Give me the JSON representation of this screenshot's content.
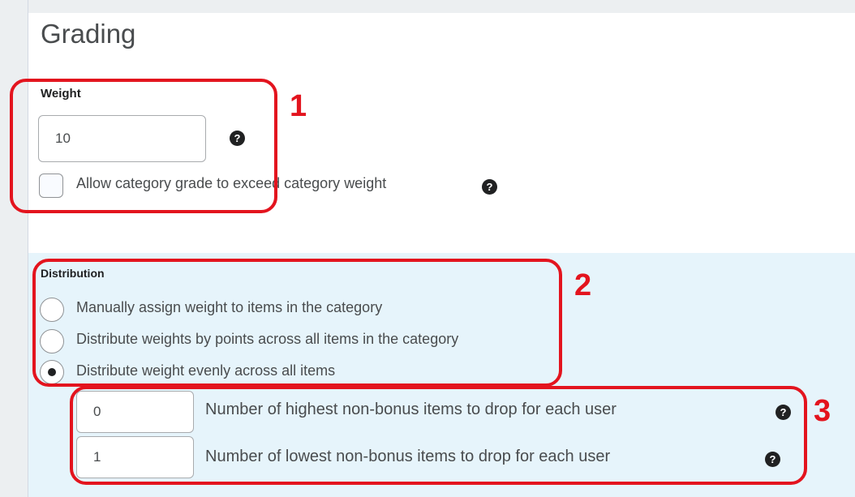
{
  "page": {
    "title": "Grading"
  },
  "weight": {
    "label": "Weight",
    "value": "10",
    "help_icon": "help-icon",
    "exceed_checkbox": {
      "label": "Allow category grade to exceed category weight",
      "checked": false
    }
  },
  "distribution": {
    "label": "Distribution",
    "options": [
      {
        "label": "Manually assign weight to items in the category",
        "selected": false
      },
      {
        "label": "Distribute weights by points across all items in the category",
        "selected": false
      },
      {
        "label": "Distribute weight evenly across all items",
        "selected": true
      }
    ],
    "drop_highest": {
      "value": "0",
      "label": "Number of highest non-bonus items to drop for each user"
    },
    "drop_lowest": {
      "value": "1",
      "label": "Number of lowest non-bonus items to drop for each user"
    }
  },
  "help_glyph": "?",
  "annotations": {
    "box1": "1",
    "box2": "2",
    "box3": "3",
    "color": "#e3141e"
  },
  "colors": {
    "distribution_background": "#e6f4fb",
    "text": "#494c4e",
    "annotation": "#e3141e"
  }
}
